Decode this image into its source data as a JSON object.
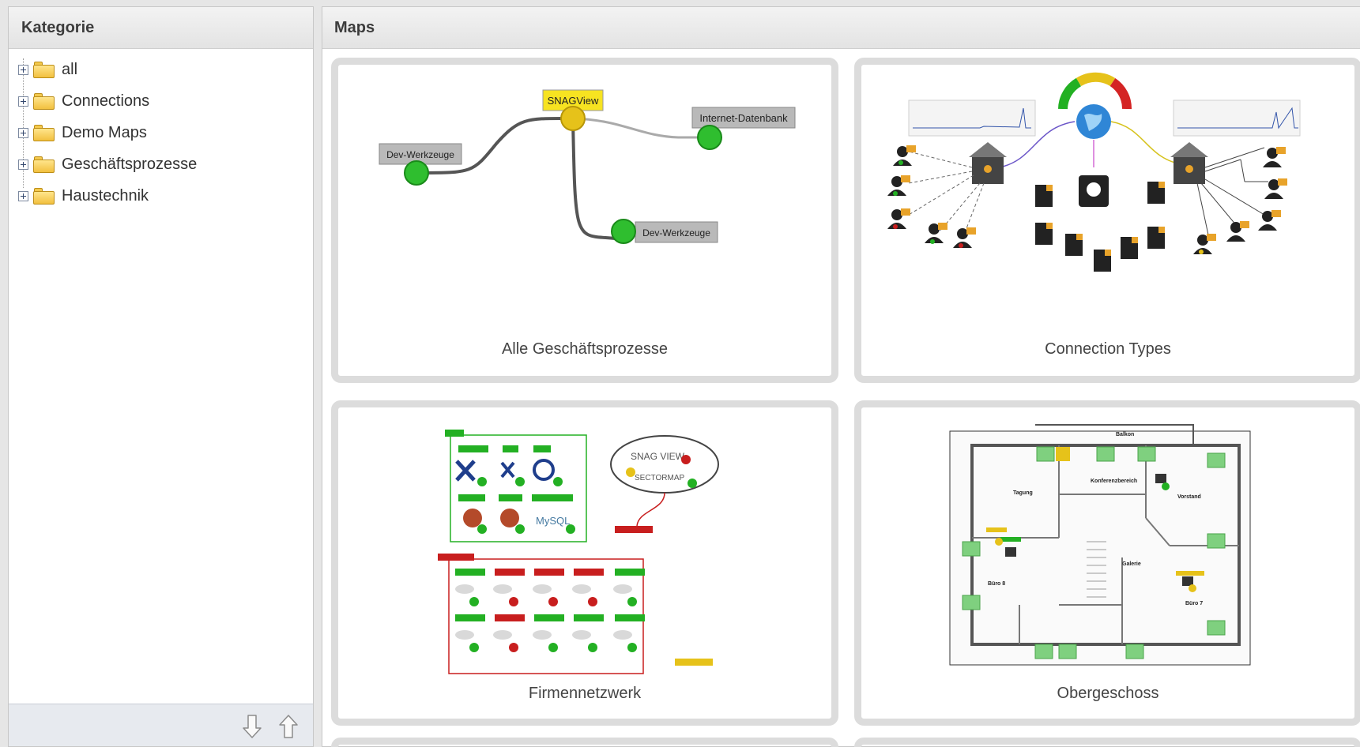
{
  "sidebar": {
    "title": "Kategorie",
    "items": [
      {
        "label": "all"
      },
      {
        "label": "Connections"
      },
      {
        "label": "Demo Maps"
      },
      {
        "label": "Geschäftsprozesse"
      },
      {
        "label": "Haustechnik"
      }
    ],
    "footer": {
      "down_icon": "arrow-down-icon",
      "up_icon": "arrow-up-icon"
    }
  },
  "main": {
    "title": "Maps",
    "cards": [
      {
        "title": "Alle Geschäftsprozesse",
        "labels": {
          "snagview": "SNAGView",
          "internet": "Internet-Datenbank",
          "dev1": "Dev-Werkzeuge",
          "dev2": "Dev-Werkzeuge"
        }
      },
      {
        "title": "Connection Types"
      },
      {
        "title": "Firmennetzwerk"
      },
      {
        "title": "Obergeschoss"
      }
    ]
  },
  "colors": {
    "status_ok": "#22b022",
    "status_warning": "#e6c21a",
    "status_critical": "#c81e1e",
    "folder": "#f5c84a",
    "card_border": "#dcdcdc"
  }
}
